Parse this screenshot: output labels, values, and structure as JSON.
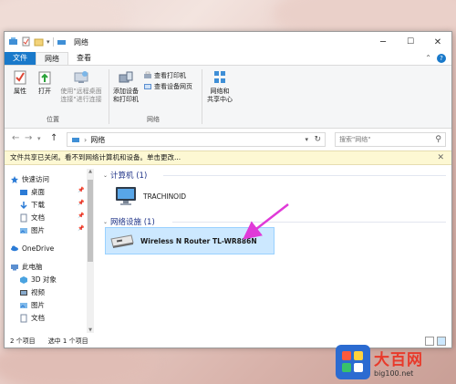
{
  "window": {
    "title": "网络",
    "minimize": "─",
    "maximize": "☐",
    "close": "✕"
  },
  "tabs": [
    {
      "label": "文件"
    },
    {
      "label": "网络"
    },
    {
      "label": "查看"
    }
  ],
  "ribbon": {
    "properties": "属性",
    "open": "打开",
    "remote_connect_1": "使用\"远程桌面",
    "remote_connect_2": "连接\"进行连接",
    "add_device_1": "添加设备",
    "add_device_2": "和打印机",
    "view_printers": "查看打印机",
    "view_device_webpage": "查看设备网页",
    "network_center_1": "网络和",
    "network_center_2": "共享中心",
    "group_location": "位置",
    "group_network": "网络"
  },
  "address": {
    "path_label": "网络",
    "search_placeholder": "搜索\"网络\""
  },
  "infobar": {
    "text": "文件共享已关闭。看不到网络计算机和设备。单击更改..."
  },
  "navpane": {
    "items": [
      {
        "label": "快速访问"
      },
      {
        "label": "桌面"
      },
      {
        "label": "下载"
      },
      {
        "label": "文档"
      },
      {
        "label": "图片"
      },
      {
        "label": "OneDrive"
      },
      {
        "label": "此电脑"
      },
      {
        "label": "3D 对象"
      },
      {
        "label": "视频"
      },
      {
        "label": "图片"
      },
      {
        "label": "文档"
      }
    ]
  },
  "content": {
    "group_computers": "计算机 (1)",
    "computer_name": "TRACHINOID",
    "group_network_devices": "网络设施 (1)",
    "device_name": "Wireless N Router TL-WR886N"
  },
  "status": {
    "item_count": "2 个项目",
    "selected_count": "选中 1 个项目"
  },
  "watermark": {
    "brand": "大百网",
    "url": "big100.net"
  },
  "colors": {
    "accent": "#1979ca",
    "infobar_bg": "#fdf8d3",
    "selection": "#cce8ff",
    "annotation_arrow": "#e03ad8"
  }
}
